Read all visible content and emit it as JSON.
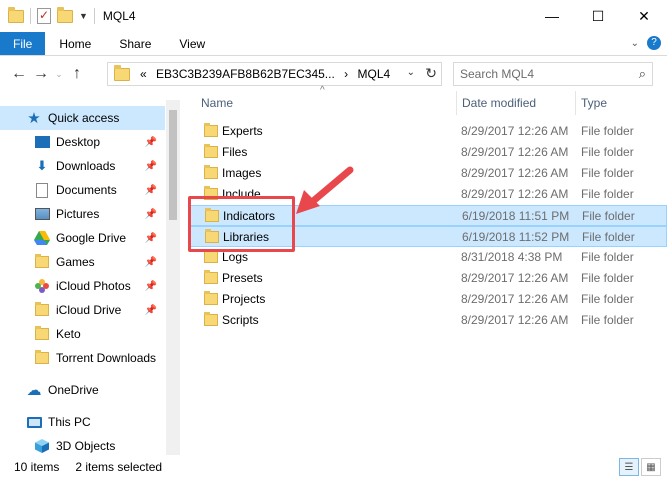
{
  "window": {
    "title": "MQL4",
    "controls": {
      "minimize": "—",
      "maximize": "☐",
      "close": "✕"
    }
  },
  "ribbon": {
    "tabs": [
      "File",
      "Home",
      "Share",
      "View"
    ],
    "expand_icon": "chevron-down-icon",
    "help_label": "?"
  },
  "address": {
    "prefix": "«",
    "path": [
      "EB3C3B239AFB8B62B7EC345...",
      "MQL4"
    ],
    "separator": "›"
  },
  "search": {
    "placeholder": "Search MQL4"
  },
  "nav": {
    "items": [
      {
        "label": "Quick access",
        "icon": "star-icon",
        "pinned": false,
        "selected": true
      },
      {
        "label": "Desktop",
        "icon": "desktop-icon",
        "pinned": true
      },
      {
        "label": "Downloads",
        "icon": "download-icon",
        "pinned": true
      },
      {
        "label": "Documents",
        "icon": "document-icon",
        "pinned": true
      },
      {
        "label": "Pictures",
        "icon": "pictures-icon",
        "pinned": true
      },
      {
        "label": "Google Drive",
        "icon": "google-drive-icon",
        "pinned": true
      },
      {
        "label": "Games",
        "icon": "folder-icon",
        "pinned": true
      },
      {
        "label": "iCloud Photos",
        "icon": "icloud-photos-icon",
        "pinned": true
      },
      {
        "label": "iCloud Drive",
        "icon": "icloud-drive-icon",
        "pinned": true
      },
      {
        "label": "Keto",
        "icon": "folder-icon",
        "pinned": false
      },
      {
        "label": "Torrent Downloads",
        "icon": "folder-icon",
        "pinned": false
      },
      {
        "label": "OneDrive",
        "icon": "onedrive-icon",
        "pinned": false
      },
      {
        "label": "This PC",
        "icon": "this-pc-icon",
        "pinned": false
      },
      {
        "label": "3D Objects",
        "icon": "3d-objects-icon",
        "pinned": false
      }
    ]
  },
  "columns": {
    "name": "Name",
    "date": "Date modified",
    "type": "Type"
  },
  "files": [
    {
      "name": "Experts",
      "date": "8/29/2017 12:26 AM",
      "type": "File folder",
      "selected": false
    },
    {
      "name": "Files",
      "date": "8/29/2017 12:26 AM",
      "type": "File folder",
      "selected": false
    },
    {
      "name": "Images",
      "date": "8/29/2017 12:26 AM",
      "type": "File folder",
      "selected": false
    },
    {
      "name": "Include",
      "date": "8/29/2017 12:26 AM",
      "type": "File folder",
      "selected": false
    },
    {
      "name": "Indicators",
      "date": "6/19/2018 11:51 PM",
      "type": "File folder",
      "selected": true
    },
    {
      "name": "Libraries",
      "date": "6/19/2018 11:52 PM",
      "type": "File folder",
      "selected": true
    },
    {
      "name": "Logs",
      "date": "8/31/2018 4:38 PM",
      "type": "File folder",
      "selected": false
    },
    {
      "name": "Presets",
      "date": "8/29/2017 12:26 AM",
      "type": "File folder",
      "selected": false
    },
    {
      "name": "Projects",
      "date": "8/29/2017 12:26 AM",
      "type": "File folder",
      "selected": false
    },
    {
      "name": "Scripts",
      "date": "8/29/2017 12:26 AM",
      "type": "File folder",
      "selected": false
    }
  ],
  "status": {
    "count": "10 items",
    "selection": "2 items selected"
  },
  "annotation": {
    "color": "#e8474c"
  }
}
